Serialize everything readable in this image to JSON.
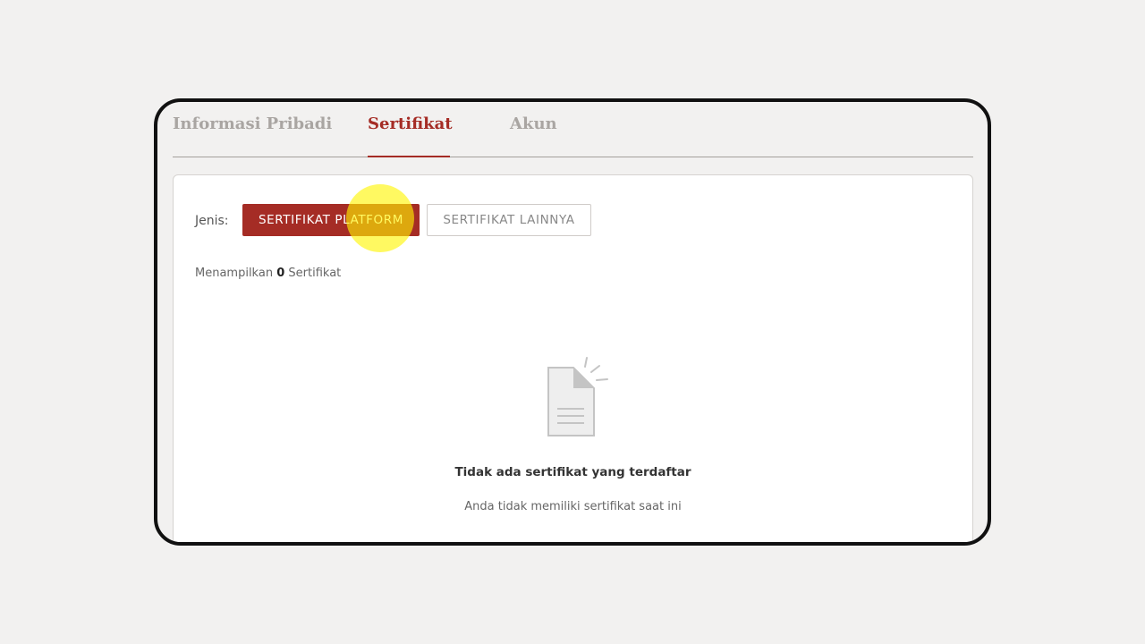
{
  "tabs": [
    {
      "label": "Informasi Pribadi",
      "active": false
    },
    {
      "label": "Sertifikat",
      "active": true
    },
    {
      "label": "Akun",
      "active": false
    }
  ],
  "filter": {
    "label": "Jenis:",
    "options": [
      {
        "label": "SERTIFIKAT PLATFORM",
        "selected": true
      },
      {
        "label": "SERTIFIKAT LAINNYA",
        "selected": false
      }
    ]
  },
  "count": {
    "prefix": "Menampilkan",
    "value": "0",
    "suffix": "Sertifikat"
  },
  "empty_state": {
    "icon": "empty-document-icon",
    "title": "Tidak ada sertifikat yang terdaftar",
    "subtitle": "Anda tidak memiliki sertifikat saat ini"
  },
  "colors": {
    "accent": "#a52c25",
    "background": "#f2f1f0",
    "highlight": "#fff500"
  }
}
